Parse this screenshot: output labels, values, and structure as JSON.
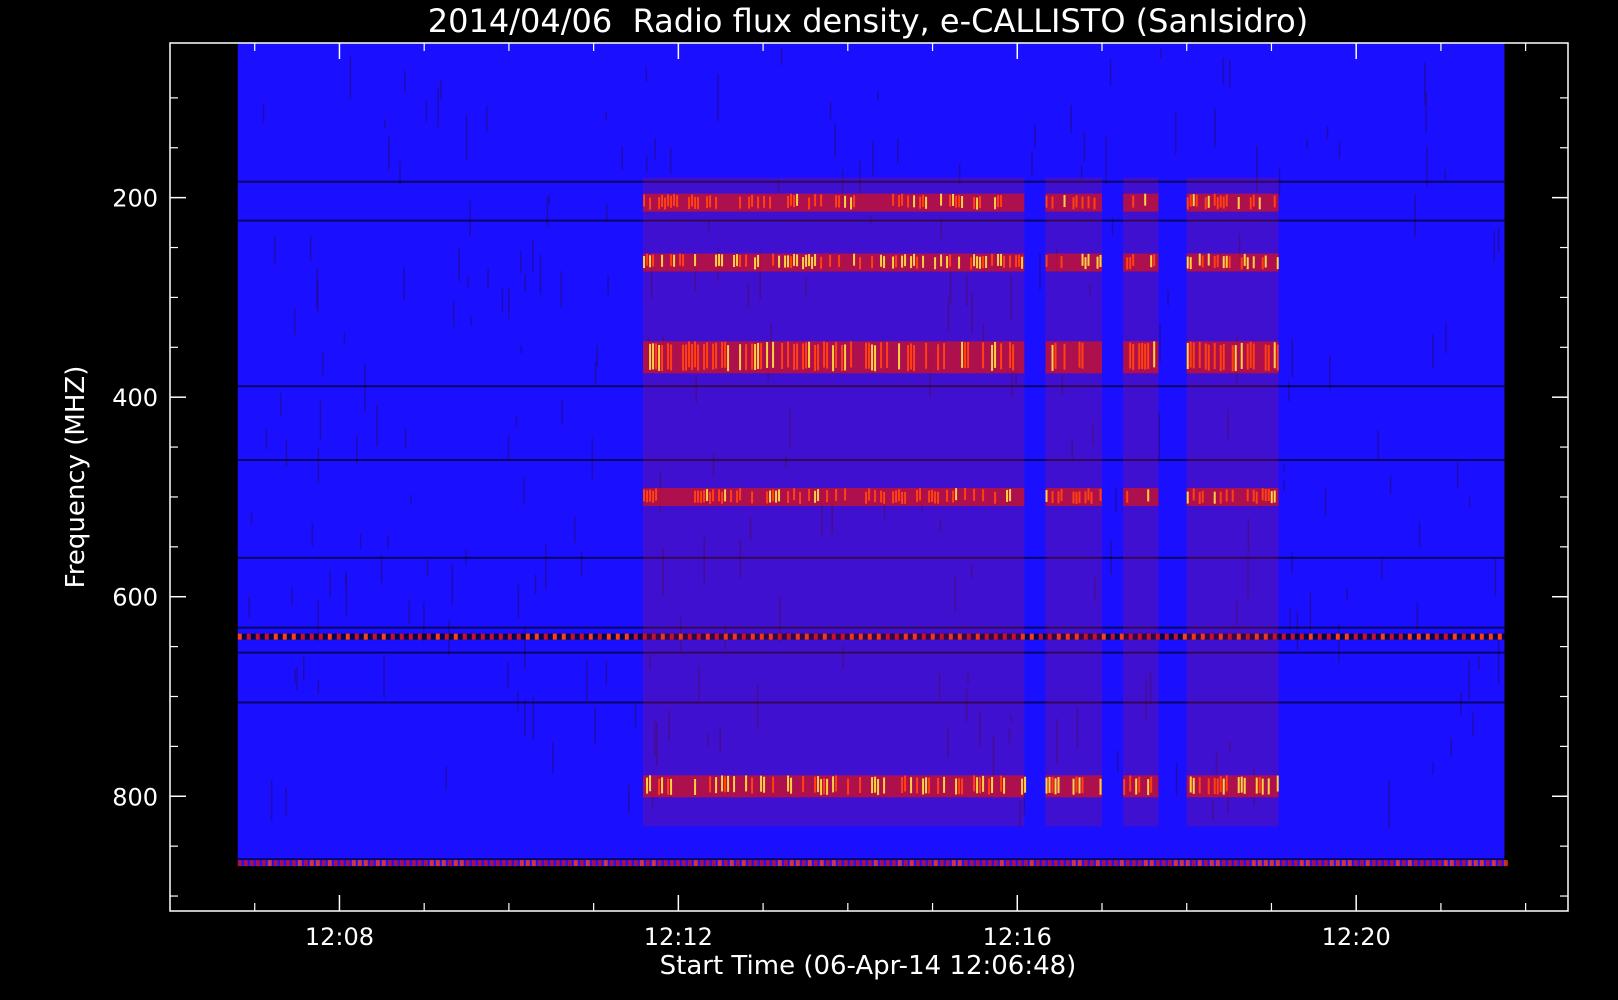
{
  "chart_data": {
    "type": "heatmap",
    "title": "2014/04/06  Radio flux density, e-CALLISTO (SanIsidro)",
    "xlabel": "Start Time (06-Apr-14 12:06:48)",
    "ylabel": "Frequency (MHZ)",
    "x_ticks": [
      "12:08",
      "12:12",
      "12:16",
      "12:20"
    ],
    "y_ticks": [
      200,
      400,
      600,
      800
    ],
    "x_range": [
      "12:06:00",
      "12:22:30"
    ],
    "y_range": [
      45,
      915
    ],
    "data_extent": {
      "x": [
        "12:06:48",
        "12:21:45"
      ],
      "y": [
        45,
        870
      ]
    },
    "y_reversed": true,
    "colormap": [
      "#000000",
      "#2a0a6e",
      "#1a10ff",
      "#c8102a",
      "#ff4010",
      "#ffd040"
    ],
    "background_color": "#1a10ff",
    "bursts": [
      {
        "t_start": "12:11:35",
        "t_end": "12:16:05",
        "f_start": 180,
        "f_end": 830
      },
      {
        "t_start": "12:16:20",
        "t_end": "12:17:00",
        "f_start": 180,
        "f_end": 830
      },
      {
        "t_start": "12:17:15",
        "t_end": "12:17:40",
        "f_start": 180,
        "f_end": 830
      },
      {
        "t_start": "12:18:00",
        "t_end": "12:19:05",
        "f_start": 180,
        "f_end": 830
      }
    ],
    "emission_lanes_mhz": [
      205,
      265,
      360,
      500,
      790
    ],
    "interference_band_mhz": 640,
    "grid": false,
    "legend": "none"
  }
}
